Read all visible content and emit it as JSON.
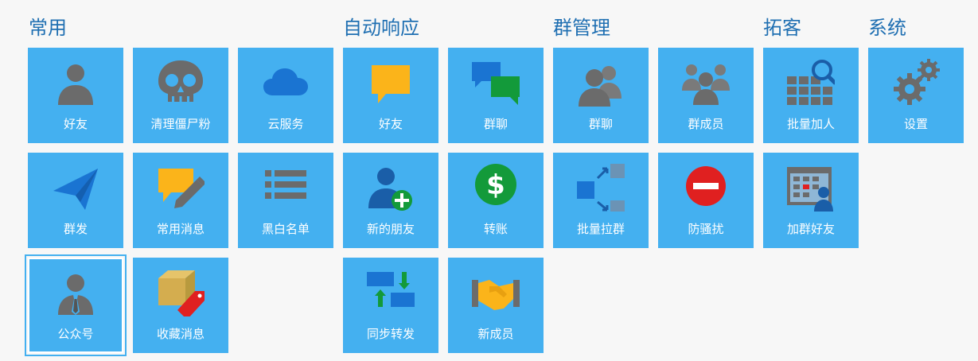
{
  "sections": {
    "common": "常用",
    "auto_reply": "自动响应",
    "group_manage": "群管理",
    "expand": "拓客",
    "system": "系统"
  },
  "tiles": {
    "friends_common": {
      "label": "好友",
      "icon": "person-icon"
    },
    "clean_zombie": {
      "label": "清理僵尸粉",
      "icon": "skull-icon"
    },
    "cloud_service": {
      "label": "云服务",
      "icon": "cloud-icon"
    },
    "auto_friends": {
      "label": "好友",
      "icon": "message-bubble-icon"
    },
    "auto_group_chat": {
      "label": "群聊",
      "icon": "chat-bubbles-icon"
    },
    "group_chat": {
      "label": "群聊",
      "icon": "people-icon"
    },
    "group_members": {
      "label": "群成员",
      "icon": "group-members-icon"
    },
    "batch_add": {
      "label": "批量加人",
      "icon": "grid-search-icon"
    },
    "settings": {
      "label": "设置",
      "icon": "gears-icon"
    },
    "mass_send": {
      "label": "群发",
      "icon": "paper-plane-icon"
    },
    "common_messages": {
      "label": "常用消息",
      "icon": "message-edit-icon"
    },
    "blacklist": {
      "label": "黑白名单",
      "icon": "list-icon"
    },
    "new_friends": {
      "label": "新的朋友",
      "icon": "person-add-icon"
    },
    "transfer": {
      "label": "转账",
      "icon": "dollar-icon"
    },
    "batch_pull_group": {
      "label": "批量拉群",
      "icon": "arrows-squares-icon"
    },
    "anti_harass": {
      "label": "防骚扰",
      "icon": "no-entry-icon"
    },
    "join_group_friends": {
      "label": "加群好友",
      "icon": "calendar-person-icon"
    },
    "official_account": {
      "label": "公众号",
      "icon": "person-tie-icon"
    },
    "favorites": {
      "label": "收藏消息",
      "icon": "box-tag-icon"
    },
    "sync_forward": {
      "label": "同步转发",
      "icon": "sync-icon"
    },
    "new_members": {
      "label": "新成员",
      "icon": "handshake-icon"
    }
  },
  "colors": {
    "tile": "#44b0f0",
    "header": "#1f6fb2",
    "icon_gray": "#6b6b6b",
    "icon_blue": "#1a74d2",
    "icon_yellow": "#fbb41a",
    "icon_green": "#139a3a",
    "icon_red": "#e02020"
  }
}
